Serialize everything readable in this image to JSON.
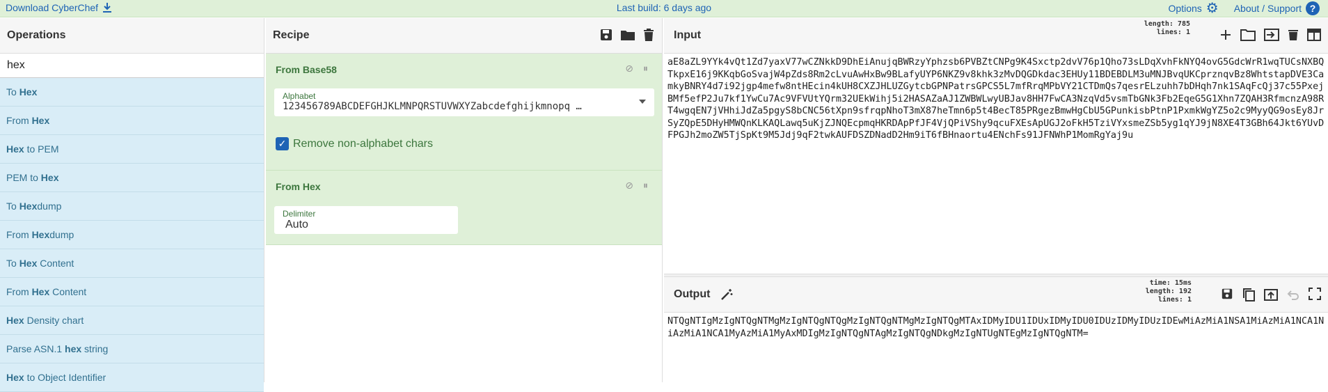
{
  "topbar": {
    "download_label": "Download CyberChef",
    "build_label": "Last build: 6 days ago",
    "options_label": "Options",
    "about_label": "About / Support"
  },
  "operations": {
    "title": "Operations",
    "search_value": "hex",
    "items": [
      {
        "pre": "To ",
        "hl": "Hex",
        "post": ""
      },
      {
        "pre": "From ",
        "hl": "Hex",
        "post": ""
      },
      {
        "pre": "",
        "hl": "Hex",
        "post": " to PEM"
      },
      {
        "pre": "PEM to ",
        "hl": "Hex",
        "post": ""
      },
      {
        "pre": "To ",
        "hl": "Hex",
        "post": "dump"
      },
      {
        "pre": "From ",
        "hl": "Hex",
        "post": "dump"
      },
      {
        "pre": "To ",
        "hl": "Hex",
        "post": " Content"
      },
      {
        "pre": "From ",
        "hl": "Hex",
        "post": " Content"
      },
      {
        "pre": "",
        "hl": "Hex",
        "post": " Density chart"
      },
      {
        "pre": "Parse ASN.1 ",
        "hl": "hex",
        "post": " string"
      },
      {
        "pre": "",
        "hl": "Hex",
        "post": " to Object Identifier"
      }
    ]
  },
  "recipe": {
    "title": "Recipe",
    "op1": {
      "name": "From Base58",
      "alphabet_label": "Alphabet",
      "alphabet_value": "123456789ABCDEFGHJKLMNPQRSTUVWXYZabcdefghijkmnopq …",
      "checkbox_label": "Remove non-alphabet chars"
    },
    "op2": {
      "name": "From Hex",
      "delimiter_label": "Delimiter",
      "delimiter_value": "Auto"
    }
  },
  "input": {
    "title": "Input",
    "length": "length: 785",
    "lines": "lines:   1",
    "text": "aE8aZL9YYk4vQt1Zd7yaxV77wCZNkkD9DhEiAnujqBWRzyYphzsb6PVBZtCNPg9K4Sxctp2dvV76p1Qho73sLDqXvhFkNYQ4ovG5GdcWrR1wqTUCsNXBQTkpxE16j9KKqbGoSvajW4pZds8Rm2cLvuAwHxBw9BLafyUYP6NKZ9v8khk3zMvDQGDkdac3EHUy11BDEBDLM3uMNJBvqUKCprznqvBz8WhtstapDVE3CamkyBNRY4d7i92jgp4mefw8ntHEcin4kUH8CXZJHLUZGytcbGPNPatrsGPCS5L7mfRrqMPbVY21CTDmQs7qesrELzuhh7bDHqh7nk1SAqFcQj37c55PxejBMf5efP2Ju7kf1YwCu7Ac9VFVUtYQrm32UEkWihj5i2HASAZaAJ1ZWBWLwyUBJav8HH7FwCA3NzqVd5vsmTbGNk3Fb2EqeG5G1Xhn7ZQAH3RfmcnzA98RT4wgqEN7jVHhiJdZa5pgyS8bCNC56tXpn9sfrqpNhoT3mX87heTmn6p5t4BecT85PRgezBmwHgCbU5GPunkisbPtnP1PxmkWgYZ5o2c9MyyQG9osEy8JrSyZQpE5DHyHMWQnKLKAQLawq5uKjZJNQEcpmqHKRDApPfJF4VjQPiVShy9qcuFXEsApUGJ2oFkH5TziVYxsmeZSb5yg1qYJ9jN8XE4T3GBh64Jkt6YUvDFPGJh2moZW5TjSpKt9M5Jdj9qF2twkAUFDSZDNadD2Hm9iT6fBHnaortu4ENchFs91JFNWhP1MomRgYaj9u"
  },
  "output": {
    "title": "Output",
    "time": "time: 15ms",
    "length": "length:  192",
    "lines": "lines:   1",
    "text": "NTQgNTIgMzIgNTQgNTMgMzIgNTQgNTQgMzIgNTQgNTMgMzIgNTQgMTAxIDMyIDU1IDUxIDMyIDU0IDUzIDMyIDUzIDEwMiAzMiA1NSA1MiAzMiA1NCA1NiAzMiA1NCA1MyAzMiA1MyAxMDIgMzIgNTQgNTAgMzIgNTQgNDkgMzIgNTUgNTEgMzIgNTQgNTM="
  },
  "colors": {
    "accent": "#1e63b5",
    "op_bg": "#d9edf7",
    "recipe_bg": "#dff0d8"
  }
}
